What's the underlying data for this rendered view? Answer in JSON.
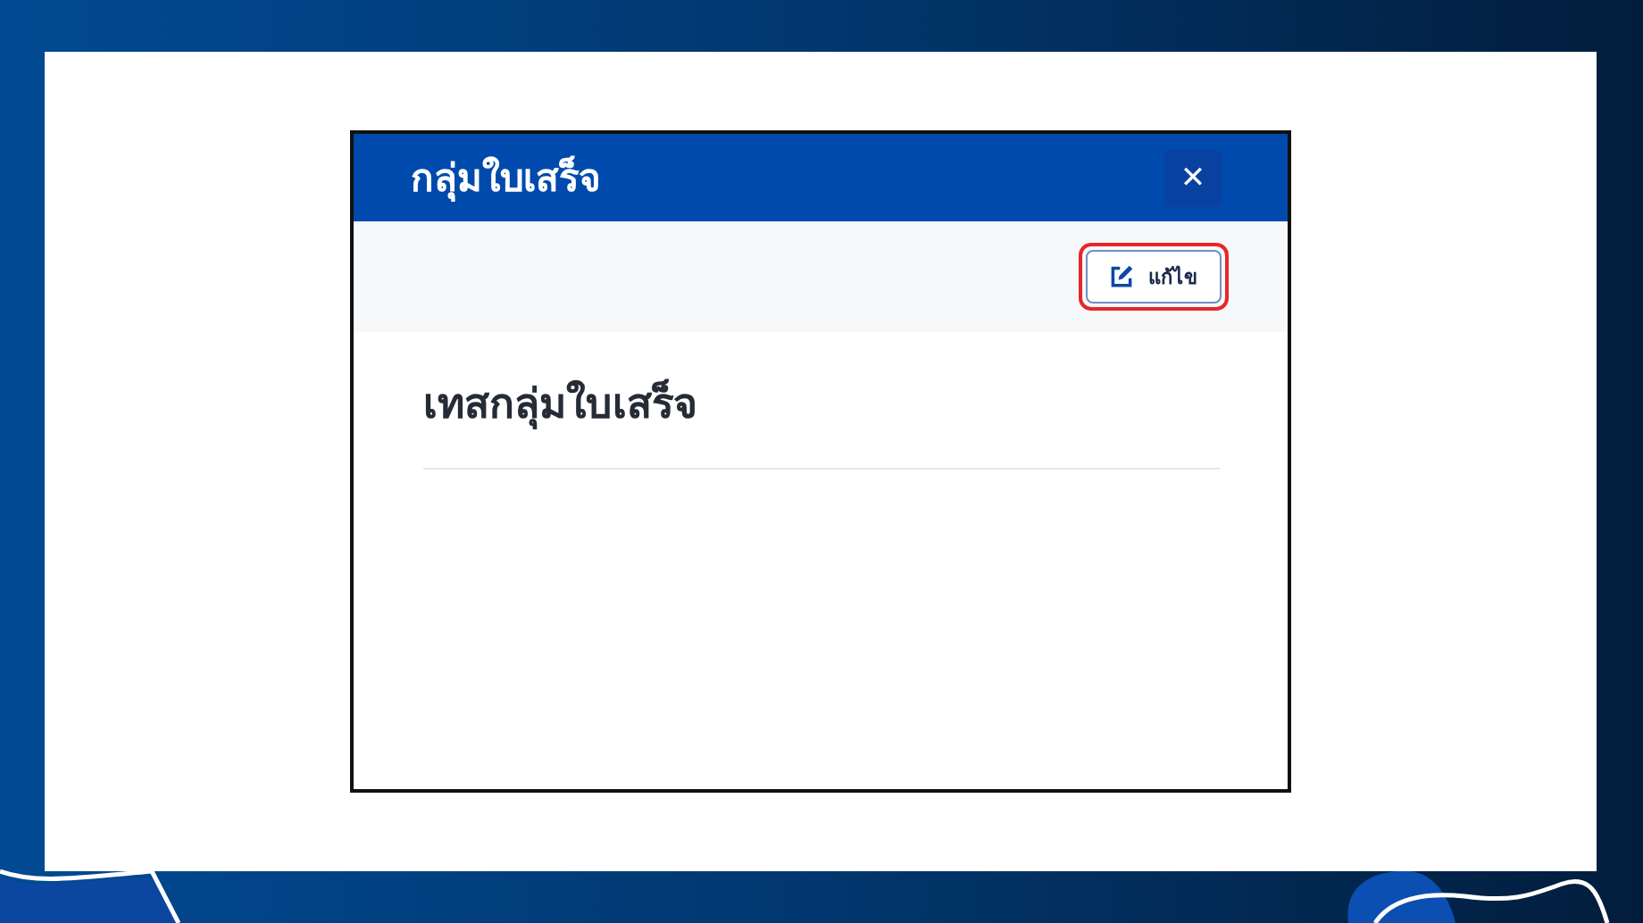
{
  "dialog": {
    "title": "กลุ่มใบเสร็จ",
    "close_icon": "✕"
  },
  "toolbar": {
    "edit_button": {
      "label": "แก้ไข",
      "highlighted": true
    }
  },
  "content": {
    "heading": "เทสกลุ่มใบเสร็จ"
  }
}
